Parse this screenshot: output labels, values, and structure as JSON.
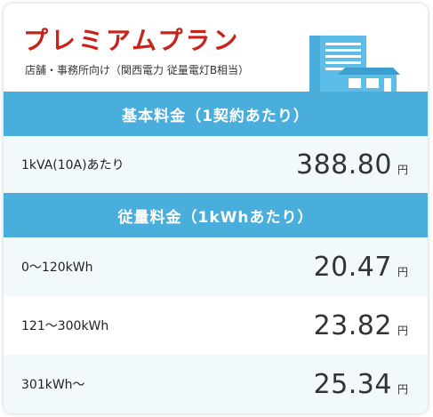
{
  "header": {
    "title": "プレミアムプラン",
    "subtitle": "店舗・事務所向け（関西電力 従量電灯B相当）",
    "illustration_icon": "office-building-icon"
  },
  "basic_section": {
    "heading": "基本料金（1契約あたり）",
    "rows": [
      {
        "label": "1kVA(10A)あたり",
        "price": "388.80",
        "unit": "円"
      }
    ]
  },
  "usage_section": {
    "heading": "従量料金（1kWhあたり）",
    "rows": [
      {
        "label": "0～120kWh",
        "price": "20.47",
        "unit": "円"
      },
      {
        "label": "121～300kWh",
        "price": "23.82",
        "unit": "円"
      },
      {
        "label": "301kWh～",
        "price": "25.34",
        "unit": "円"
      }
    ]
  },
  "colors": {
    "title_red": "#c8231b",
    "band_blue": "#4aaedc",
    "row_tint": "#f2f9fc",
    "text_dark": "#333333"
  }
}
